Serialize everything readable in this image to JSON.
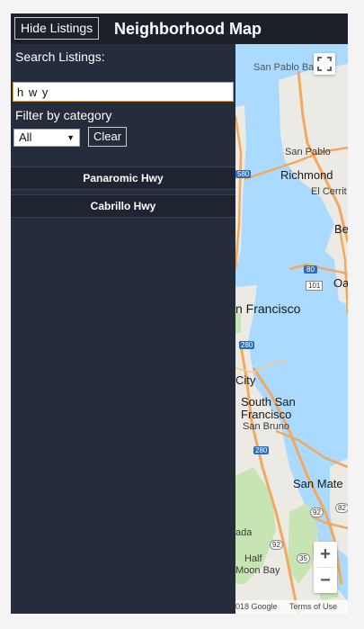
{
  "header": {
    "toggle_label": "Hide Listings",
    "title": "Neighborhood Map"
  },
  "sidebar": {
    "search_label": "Search Listings:",
    "search_value": "h w y",
    "filter_label": "Filter by category",
    "category_selected": "All",
    "clear_label": "Clear",
    "listings": [
      {
        "label": "Panaromic Hwy"
      },
      {
        "label": "Cabrillo Hwy"
      }
    ]
  },
  "map": {
    "places": {
      "san_pablo_bay": "San Pablo Bay",
      "san_pablo": "San Pablo",
      "richmond": "Richmond",
      "el_cerrito": "El Cerrit",
      "berkeley": "Be",
      "oakland": "Oa",
      "san_francisco": "n Francisco",
      "daly_city": "City",
      "south_sf_1": "South San",
      "south_sf_2": "Francisco",
      "san_bruno": "San Bruno",
      "san_mateo": "San Mate",
      "pacifica": "ada",
      "half_moon_1": "Half",
      "half_moon_2": "Moon Bay"
    },
    "shields": {
      "i580": "580",
      "i80": "80",
      "i280a": "280",
      "i280b": "280",
      "us101": "101",
      "r92a": "92",
      "r92b": "92",
      "r35": "35",
      "r82": "82"
    },
    "zoom_in": "+",
    "zoom_out": "−",
    "copyright": "018 Google",
    "terms": "Terms of Use"
  },
  "colors": {
    "header_bg": "#1c2029",
    "sidebar_bg": "#252c3b",
    "water": "#aadaff",
    "land": "#eceae4",
    "park": "#c6e5b3",
    "freeway": "#f3a95d",
    "input_border": "#d5a243"
  }
}
